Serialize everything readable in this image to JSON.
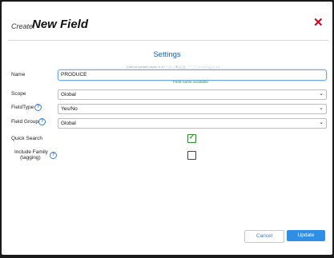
{
  "dialog": {
    "create_prefix": "Create:",
    "title": "New Field",
    "close_icon": "close-icon"
  },
  "settings": {
    "title": "Settings",
    "hint": "Cannot contain chars: # & * ^ | \\ ; / $ { [ ] } ` ' \" ' ' \" \" = < > ! ( ) < = >",
    "name_label": "Name",
    "name_value": "PRODUCE",
    "name_status": "Field name available",
    "scope_label": "Scope",
    "scope_value": "Global",
    "fieldtype_label": "FieldType",
    "fieldtype_value": "Yes/No",
    "fieldgroup_label": "Field Group",
    "fieldgroup_value": "Global",
    "quicksearch_label": "Quick Search",
    "quicksearch_checked": true,
    "include_family_label_1": "Include Family",
    "include_family_label_2": "(tagging)",
    "include_family_checked": false,
    "help_glyph": "?"
  },
  "footer": {
    "cancel_label": "Cancel",
    "update_label": "Update"
  },
  "colors": {
    "accent": "#2f8fe4",
    "close": "#d0021b",
    "success": "#2a9d3a"
  }
}
